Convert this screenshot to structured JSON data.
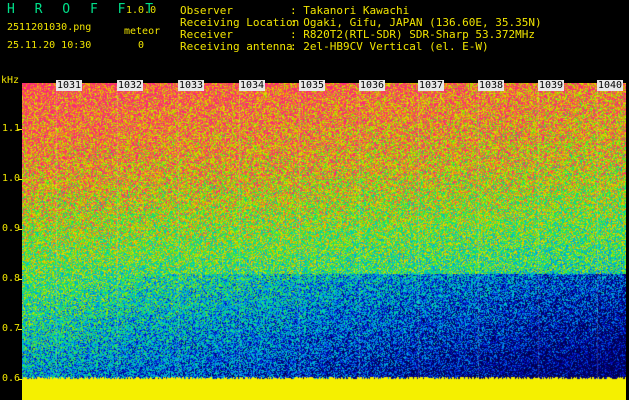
{
  "app": {
    "title": "H R O F F T",
    "version": "1.0.0"
  },
  "file": {
    "name": "2511201030.png",
    "datetime": "25.11.20 10:30"
  },
  "meteor": {
    "label": "meteor",
    "count": "0"
  },
  "info": [
    {
      "key": "Observer",
      "value": ": Takanori Kawachi"
    },
    {
      "key": "Receiving Location",
      "value": ": Ogaki, Gifu, JAPAN (136.60E, 35.35N)"
    },
    {
      "key": "Receiver",
      "value": ": R820T2(RTL-SDR) SDR-Sharp 53.372MHz"
    },
    {
      "key": "Receiving antenna",
      "value": ": 2el-HB9CV Vertical (el. E-W)"
    }
  ],
  "axis": {
    "unit": "kHz",
    "y_labels": [
      "1.1",
      "1.0",
      "0.9",
      "0.8",
      "0.7",
      "0.6"
    ],
    "x_labels": [
      "1031",
      "1032",
      "1033",
      "1034",
      "1035",
      "1036",
      "1037",
      "1038",
      "1039",
      "1040"
    ]
  },
  "colors": {
    "text": "#f0e400",
    "title": "#00e08a",
    "baseline": "#f5f000"
  }
}
